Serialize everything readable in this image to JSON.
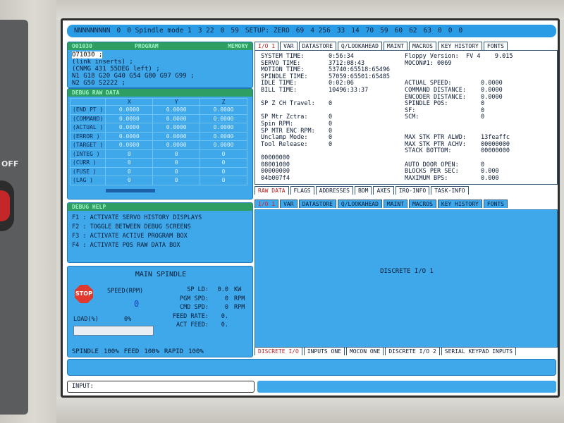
{
  "bezel": {
    "off_label": "OFF"
  },
  "status_bar": [
    "NNNNNNNNN",
    "0",
    "0 Spindle mode 1",
    "3 22",
    "0",
    "59",
    "SETUP: ZERO",
    "69",
    "4 256",
    "33",
    "14",
    "70",
    "59",
    "60",
    "62",
    "63",
    "0",
    "0",
    "0"
  ],
  "program": {
    "head_left": "O01030",
    "head_center": "PROGRAM",
    "head_right": "MEMORY",
    "lines": [
      "O71030 ;",
      "(link inserts) ;",
      "(CNMG 431 55DEG left) ;",
      "N1 G18 G20 G40 G54 G80 G97 G99 ;",
      "N2 G50 S2222 ;"
    ]
  },
  "raw_data": {
    "head": "DEBUG RAW DATA",
    "columns": [
      "",
      "X",
      "Y",
      "Z"
    ],
    "rows": [
      {
        "label": "(END PT )",
        "x": "0.0000",
        "y": "0.0000",
        "z": "0.0000"
      },
      {
        "label": "(COMMAND)",
        "x": "0.0000",
        "y": "0.0000",
        "z": "0.0000"
      },
      {
        "label": "(ACTUAL )",
        "x": "0.0000",
        "y": "0.0000",
        "z": "0.0000"
      },
      {
        "label": "(ERROR  )",
        "x": "0.0000",
        "y": "0.0000",
        "z": "0.0000"
      },
      {
        "label": "(TARGET )",
        "x": "0.0000",
        "y": "0.0000",
        "z": "0.0000"
      },
      {
        "label": "(INTEG  )",
        "x": "0",
        "y": "0",
        "z": "0"
      },
      {
        "label": "(CURR   )",
        "x": "0",
        "y": "0",
        "z": "0"
      },
      {
        "label": "(FUSE   )",
        "x": "0",
        "y": "0",
        "z": "0"
      },
      {
        "label": "(LAG    )",
        "x": "0",
        "y": "0",
        "z": "0"
      }
    ]
  },
  "debug_help": {
    "head": "DEBUG HELP",
    "lines": [
      "F1 : ACTIVATE SERVO HISTORY DISPLAYS",
      "F2 : TOGGLE BETWEEN DEBUG SCREENS",
      "F3 : ACTIVATE ACTIVE PROGRAM BOX",
      "F4 : ACTIVATE POS RAW DATA BOX"
    ]
  },
  "spindle": {
    "title": "MAIN SPINDLE",
    "stop": "STOP",
    "rpm_label": "SPEED(RPM)",
    "rpm_value": "0",
    "load_label": "LOAD(%)",
    "load_pct": "0%",
    "load_fraction": 0,
    "rows": [
      {
        "label": "SP LD:",
        "value": "0.0",
        "unit": "KW"
      },
      {
        "label": "PGM SPD:",
        "value": "0",
        "unit": "RPM"
      },
      {
        "label": "CMD SPD:",
        "value": "0",
        "unit": "RPM"
      },
      {
        "label": "FEED RATE:",
        "value": "0.",
        "unit": ""
      },
      {
        "label": "ACT FEED:",
        "value": "0.",
        "unit": ""
      }
    ],
    "footer": [
      "SPINDLE",
      "100%",
      "FEED",
      "100%",
      "RAPID",
      "100%"
    ]
  },
  "top_tabs": [
    "I/O 1",
    "VAR",
    "DATASTORE",
    "Q/LOOKAHEAD",
    "MAINT",
    "MACROS",
    "KEY HISTORY",
    "FONTS"
  ],
  "info_left": [
    [
      "SYSTEM TIME:",
      "0:56:34"
    ],
    [
      "SERVO TIME:",
      "3712:08:43"
    ],
    [
      "MOTION TIME:",
      "53740:65518:65496"
    ],
    [
      "SPINDLE TIME:",
      "57059:65501:65485"
    ],
    [
      "IDLE TIME:",
      "0:02:06"
    ],
    [
      "BILL TIME:",
      "10496:33:37"
    ],
    [
      "",
      ""
    ],
    [
      "SP Z CH Travel:",
      "0"
    ],
    [
      "",
      ""
    ],
    [
      "SP Mtr Zctra:",
      "0"
    ],
    [
      "Spin RPM:",
      "0"
    ],
    [
      "SP MTR ENC RPM:",
      "0"
    ],
    [
      "Unclamp Mode:",
      "0"
    ],
    [
      "Tool Release:",
      "0"
    ],
    [
      "",
      ""
    ],
    [
      "00000000",
      ""
    ],
    [
      "08001000",
      ""
    ],
    [
      "00000000",
      ""
    ],
    [
      "04b007f4",
      ""
    ]
  ],
  "info_right": [
    [
      "Floppy Version:  FV 4    9.015",
      ""
    ],
    [
      "MOCON#1: 0069",
      ""
    ],
    [
      "",
      ""
    ],
    [
      "",
      ""
    ],
    [
      "ACTUAL SPEED:",
      "0.0000"
    ],
    [
      "COMMAND DISTANCE:",
      "0.0000"
    ],
    [
      "ENCODER DISTANCE:",
      "0.0000"
    ],
    [
      "SPINDLE POS:",
      "0"
    ],
    [
      "SF:",
      "0"
    ],
    [
      "SCM:",
      "0"
    ],
    [
      "",
      ""
    ],
    [
      "",
      ""
    ],
    [
      "MAX STK PTR ALWD:",
      "13feaffc"
    ],
    [
      "MAX STK PTR ACHV:",
      "00000000"
    ],
    [
      "STACK BOTTOM:",
      "00000000"
    ],
    [
      "",
      ""
    ],
    [
      "AUTO DOOR OPEN:",
      "0"
    ],
    [
      "BLOCKS PER SEC:",
      "0.000"
    ],
    [
      "MAXIMUM BPS:",
      "0.000"
    ]
  ],
  "mid_tabs": [
    "RAW DATA",
    "FLAGS",
    "ADDRESSES",
    "BDM",
    "AXES",
    "IRQ-INFO",
    "TASK-INFO"
  ],
  "dio_tabs": [
    "I/O 1",
    "VAR",
    "DATASTORE",
    "Q/LOOKAHEAD",
    "MAINT",
    "MACROS",
    "KEY HISTORY",
    "FONTS"
  ],
  "dio_center": "DISCRETE I/O 1",
  "bottom_tabs": [
    "DISCRETE I/O",
    "INPUTS ONE",
    "MOCON ONE",
    "DISCRETE I/O 2",
    "SERIAL KEYPAD INPUTS"
  ],
  "input_label": "INPUT:"
}
